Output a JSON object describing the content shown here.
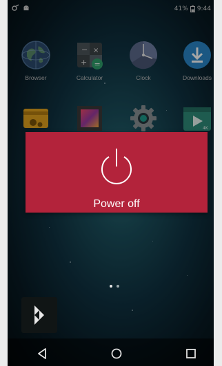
{
  "status_bar": {
    "battery_percent": "41%",
    "time": "9:44",
    "left_icons": [
      "notification-icon",
      "android-icon"
    ]
  },
  "apps": [
    {
      "label": "Browser",
      "icon": "browser-globe-icon"
    },
    {
      "label": "Calculator",
      "icon": "calculator-icon"
    },
    {
      "label": "Clock",
      "icon": "clock-icon"
    },
    {
      "label": "Downloads",
      "icon": "downloads-icon"
    },
    {
      "label": "",
      "icon": "settings-card-icon"
    },
    {
      "label": "",
      "icon": "gallery-icon"
    },
    {
      "label": "",
      "icon": "gear-icon"
    },
    {
      "label": "",
      "icon": "video-4k-icon"
    }
  ],
  "dialog": {
    "label": "Power off",
    "icon": "power-icon",
    "color": "#b3233b"
  },
  "page_indicator": {
    "pages": 2,
    "active": 0
  },
  "nav_bar": {
    "buttons": [
      "back-icon",
      "home-icon",
      "recents-icon"
    ]
  }
}
